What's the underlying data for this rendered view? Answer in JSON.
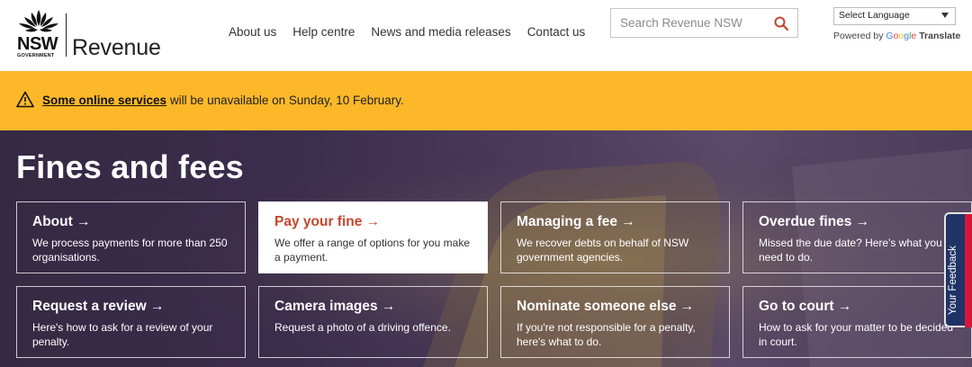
{
  "header": {
    "logo_top": "NSW",
    "logo_sub": "GOVERNMENT",
    "brand": "Revenue",
    "nav": [
      "About us",
      "Help centre",
      "News and media releases",
      "Contact us"
    ],
    "search_placeholder": "Search Revenue NSW",
    "language_select": "Select Language",
    "powered_by": "Powered by",
    "google": [
      "G",
      "o",
      "o",
      "g",
      "l",
      "e"
    ],
    "translate": "Translate"
  },
  "alert": {
    "link": "Some online services",
    "text": " will be unavailable on Sunday, 10 February."
  },
  "hero": {
    "title": "Fines and fees",
    "cards": [
      {
        "title": "About →",
        "desc": "We process payments for more than 250 organisations."
      },
      {
        "title": "Pay your fine →",
        "desc": "We offer a range of options for you make a payment."
      },
      {
        "title": "Managing a fee →",
        "desc": "We recover debts on behalf of NSW government agencies."
      },
      {
        "title": "Overdue fines →",
        "desc": "Missed the due date? Here's what you need to do."
      },
      {
        "title": "Request a review →",
        "desc": "Here's how to ask for a review of your penalty."
      },
      {
        "title": "Camera images →",
        "desc": "Request a photo of a driving offence."
      },
      {
        "title": "Nominate someone else →",
        "desc": "If you're not responsible for a penalty, here's what to do."
      },
      {
        "title": "Go to court →",
        "desc": "How to ask for your matter to be decided in court."
      }
    ]
  },
  "feedback": "Your Feedback",
  "colors": {
    "alert_bg": "#fcb829",
    "active_card_title": "#c5462b",
    "search_icon": "#c5462b",
    "feedback_bg": "#1f3465",
    "feedback_accent": "#d7153a"
  }
}
